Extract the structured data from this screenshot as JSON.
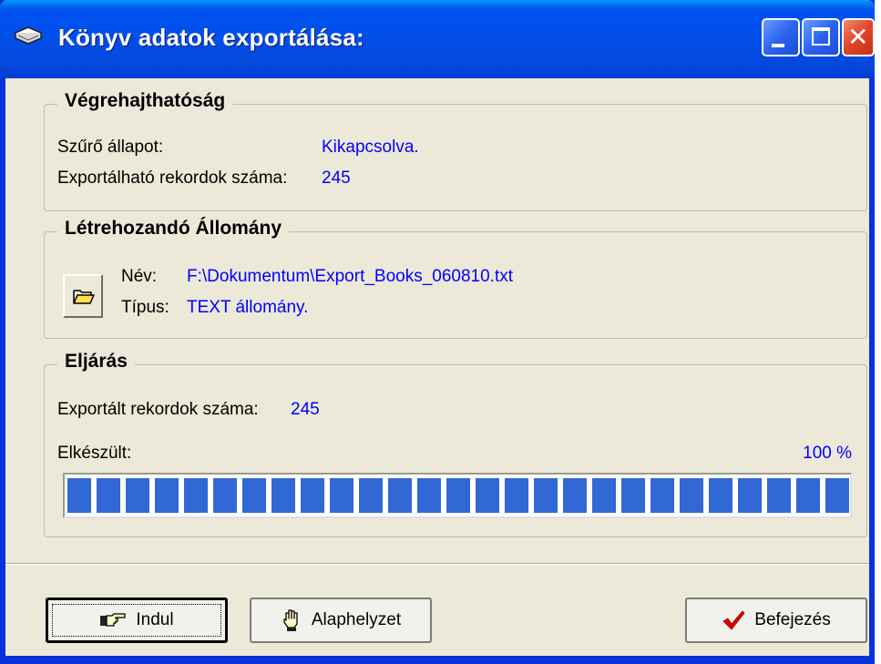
{
  "window": {
    "title": "Könyv adatok exportálása:",
    "icon": "book-icon",
    "controls": [
      "minimize-icon",
      "maximize-icon",
      "close-icon"
    ]
  },
  "executability": {
    "title": "Végrehajthatóság",
    "filter_label": "Szűrő állapot:",
    "filter_value": "Kikapcsolva.",
    "records_label": "Exportálható rekordok száma:",
    "records_value": "245"
  },
  "output_file": {
    "title": "Létrehozandó Állomány",
    "name_label": "Név:",
    "name_value": "F:\\Dokumentum\\Export_Books_060810.txt",
    "type_label": "Típus:",
    "type_value": "TEXT állomány.",
    "browse_icon": "folder-open-icon"
  },
  "procedure": {
    "title": "Eljárás",
    "exported_label": "Exportált rekordok száma:",
    "exported_value": "245",
    "done_label": "Elkészült:",
    "done_percent_text": "100 %",
    "progress_fraction": 1.0
  },
  "buttons": {
    "start_label": "Indul",
    "start_icon": "pointing-hand-icon",
    "reset_label": "Alaphelyzet",
    "reset_icon": "raised-hand-icon",
    "finish_label": "Befejezés",
    "finish_icon": "checkmark-icon"
  },
  "colors": {
    "title_bar": "#0053ee",
    "value_text": "#0000ff",
    "progress_fill": "#3168d5",
    "dialog_bg": "#ece9d8"
  }
}
